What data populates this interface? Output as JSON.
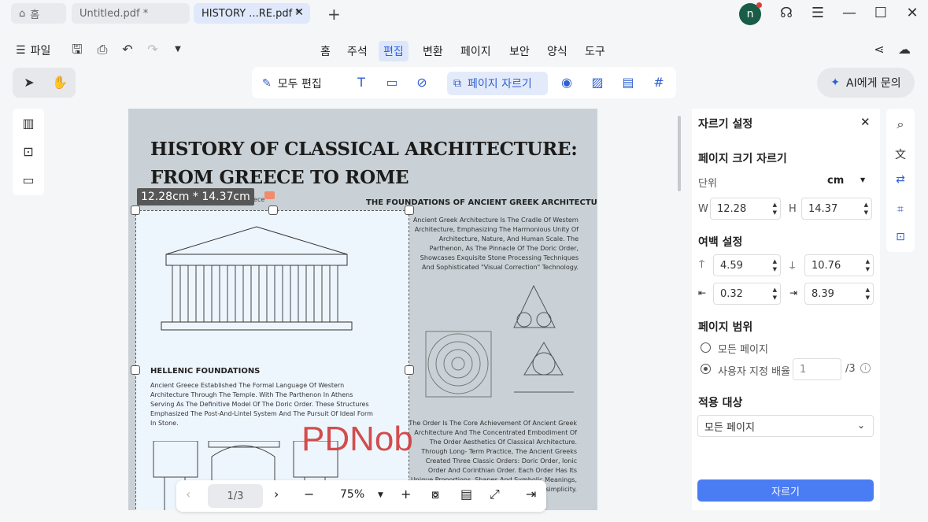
{
  "tabs": {
    "home": "홈",
    "untitled": "Untitled.pdf *",
    "history": "HISTORY ...RE.pdf *"
  },
  "avatar_letter": "n",
  "menubar": {
    "file": "파일",
    "items": [
      "홈",
      "주석",
      "편집",
      "변환",
      "페이지",
      "보안",
      "양식",
      "도구"
    ],
    "active": "편집"
  },
  "toolbar": {
    "edit_all": "모두 편집",
    "page_crop": "페이지 자르기",
    "ai": "AI에게 문의"
  },
  "document": {
    "title_line1": "HISTORY OF CLASSICAL  ARCHITECTURE:",
    "title_line2": "FROM GREECE TO ROME",
    "dimension": "12.28cm * 14.37cm",
    "hidden_sub": "reece",
    "foundations_heading": "THE FOUNDATIONS OF ANCIENT GREEK ARCHITECTURE",
    "foundations_text": "Ancient Greek Architecture Is The Cradle Of Western Architecture, Emphasizing The Harmonious Unity Of Architecture, Nature, And Human Scale. The Parthenon, As The Pinnacle Of The Doric Order, Showcases Exquisite Stone Processing Techniques And Sophisticated \"Visual Correction\" Technology.",
    "hellenic_heading": "HELLENIC FOUNDATIONS",
    "hellenic_text": "Ancient Greece Established The Formal Language Of Western Architecture Through The Temple. With The Parthenon In Athens Serving As The Definitive Model Of The Doric Order. These Structures Emphasized The Post-And-Lintel System And The Pursuit Of Ideal Form In Stone.",
    "order_text": "The Order Is The Core Achievement Of Ancient Greek Architecture And The Concentrated Embodiment Of The Order Aesthetics Of Classical Architecture. Through Long- Term Practice, The Ancient Greeks Created Three Classic Orders: Doric Order, Ionic Order And Corinthian Order. Each Order Has Its Unique Proportions, Shapes And Symbolic Meanings, Which ... of Ancient ... Earliest ... simplicity.",
    "watermark": "PDNob"
  },
  "pagenav": {
    "page": "1/3",
    "zoom": "75%"
  },
  "panel": {
    "title": "자르기 설정",
    "crop_size": "페이지 크기 자르기",
    "unit_label": "단위",
    "unit": "cm",
    "w_label": "W",
    "w": "12.28",
    "h_label": "H",
    "h": "14.37",
    "margin": "여백 설정",
    "top": "4.59",
    "bottom": "10.76",
    "left": "0.32",
    "right": "8.39",
    "range": "페이지 범위",
    "all_pages": "모든 페이지",
    "custom": "사용자 지정 배율",
    "custom_val": "1",
    "custom_total": "/3",
    "apply_to": "적용 대상",
    "apply_val": "모든 페이지",
    "crop_button": "자르기"
  }
}
